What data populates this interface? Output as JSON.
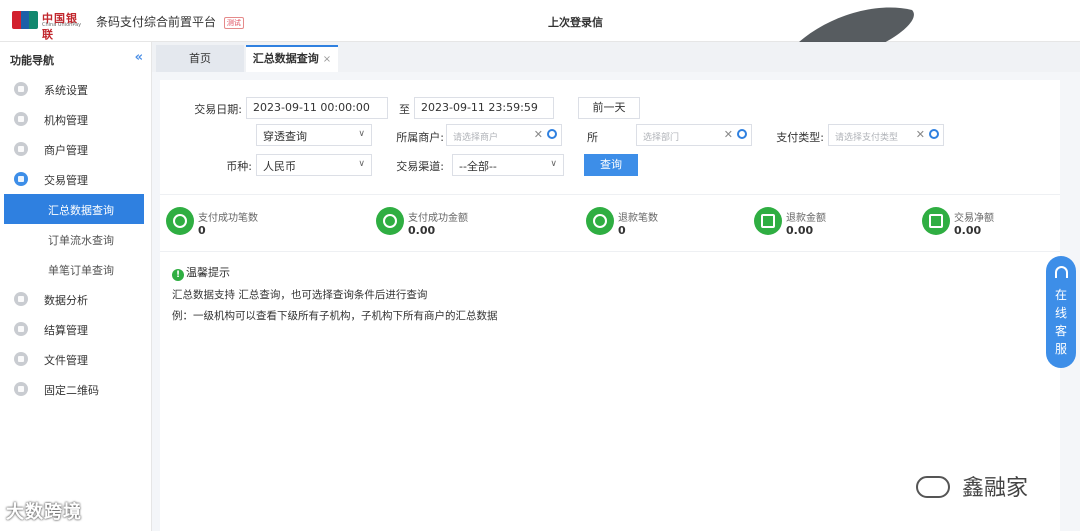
{
  "header": {
    "logo_cn": "中国银联",
    "logo_en": "China UnionPay",
    "app_title": "条码支付综合前置平台",
    "app_badge": "测试",
    "last_login": "上次登录信"
  },
  "sidebar": {
    "title": "功能导航",
    "collapse": "«",
    "menu": [
      {
        "label": "系统设置"
      },
      {
        "label": "机构管理"
      },
      {
        "label": "商户管理"
      },
      {
        "label": "交易管理"
      },
      {
        "label": "数据分析"
      },
      {
        "label": "结算管理"
      },
      {
        "label": "文件管理"
      },
      {
        "label": "固定二维码"
      }
    ],
    "submenu": [
      {
        "label": "汇总数据查询"
      },
      {
        "label": "订单流水查询"
      },
      {
        "label": "单笔订单查询"
      }
    ]
  },
  "tabs": {
    "home": "首页",
    "active": "汇总数据查询",
    "close": "×"
  },
  "form": {
    "date_label": "交易日期:",
    "date_start": "2023-09-11  00:00:00",
    "date_to": "至",
    "date_end": "2023-09-11  23:59:59",
    "prev_day": "前一天",
    "org_select": "穿透查询",
    "merchant_label": "所属商户:",
    "merchant_placeholder": "请选择商户",
    "dept_label": "所",
    "dept_placeholder": "选择部门",
    "paytype_label": "支付类型:",
    "paytype_placeholder": "请选择支付类型",
    "currency_label": "币种:",
    "currency_value": "人民币",
    "channel_label": "交易渠道:",
    "channel_value": "--全部--",
    "query_button": "查询"
  },
  "stats": [
    {
      "name": "支付成功笔数",
      "value": "0"
    },
    {
      "name": "支付成功金额",
      "value": "0.00"
    },
    {
      "name": "退款笔数",
      "value": "0"
    },
    {
      "name": "退款金额",
      "value": "0.00"
    },
    {
      "name": "交易净额",
      "value": "0.00"
    }
  ],
  "tips": {
    "title": "温馨提示",
    "line1": "汇总数据支持          汇总查询，也可选择查询条件后进行查询",
    "line2": "例：一级机构可以查看下级所有子机构，子机构下所有商户的汇总数据"
  },
  "service": [
    "在",
    "线",
    "客",
    "服"
  ],
  "watermark": {
    "left": "大数跨境",
    "right": "鑫融家"
  }
}
